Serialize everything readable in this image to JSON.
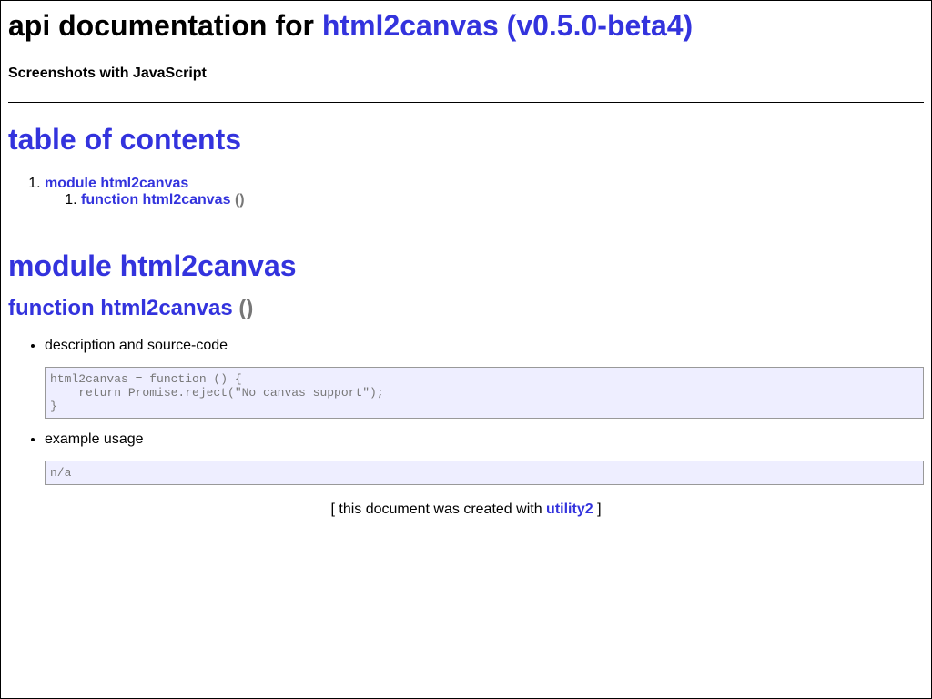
{
  "header": {
    "title_prefix": "api documentation for",
    "title_link": "html2canvas (v0.5.0-beta4)",
    "subtitle": "Screenshots with JavaScript"
  },
  "toc": {
    "title": "table of contents",
    "items": [
      {
        "label": "module html2canvas",
        "children": [
          {
            "label": "function html2canvas",
            "suffix": "()"
          }
        ]
      }
    ]
  },
  "module": {
    "title": "module html2canvas",
    "function": {
      "name": "function html2canvas",
      "signature": "()",
      "description_label": "description and source-code",
      "source_code": "html2canvas = function () {\n    return Promise.reject(\"No canvas support\");\n}",
      "example_label": "example usage",
      "example_code": "n/a"
    }
  },
  "footer": {
    "prefix": "[ this document was created with",
    "link": "utility2",
    "suffix": "]"
  }
}
